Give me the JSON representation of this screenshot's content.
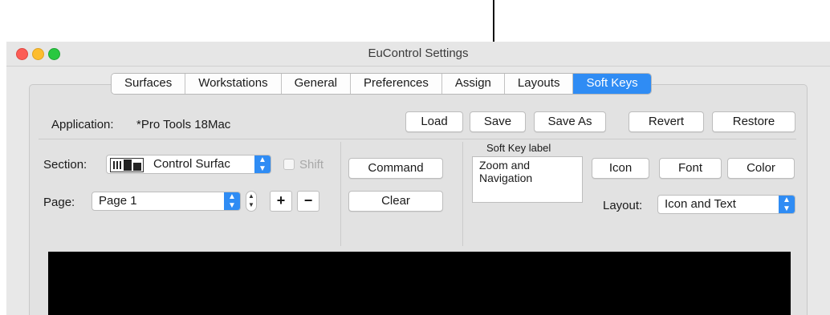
{
  "window": {
    "title": "EuControl Settings"
  },
  "tabs": [
    {
      "label": "Surfaces",
      "selected": false
    },
    {
      "label": "Workstations",
      "selected": false
    },
    {
      "label": "General",
      "selected": false
    },
    {
      "label": "Preferences",
      "selected": false
    },
    {
      "label": "Assign",
      "selected": false
    },
    {
      "label": "Layouts",
      "selected": false
    },
    {
      "label": "Soft Keys",
      "selected": true
    }
  ],
  "application": {
    "label": "Application:",
    "value": "*Pro Tools 18Mac"
  },
  "top_buttons": {
    "load": "Load",
    "save": "Save",
    "save_as": "Save As",
    "revert": "Revert",
    "restore": "Restore"
  },
  "section": {
    "label": "Section:",
    "value": "Control Surfac",
    "shift_label": "Shift"
  },
  "page": {
    "label": "Page:",
    "value": "Page 1",
    "plus": "+",
    "minus": "−"
  },
  "actions": {
    "command": "Command",
    "clear": "Clear"
  },
  "soft_key": {
    "label": "Soft Key label",
    "text_line1": "Zoom and",
    "text_line2": "Navigation"
  },
  "style_buttons": {
    "icon": "Icon",
    "font": "Font",
    "color": "Color"
  },
  "layout": {
    "label": "Layout:",
    "value": "Icon and Text"
  },
  "colors": {
    "accent": "#2f8cf4",
    "display": "#000000"
  }
}
